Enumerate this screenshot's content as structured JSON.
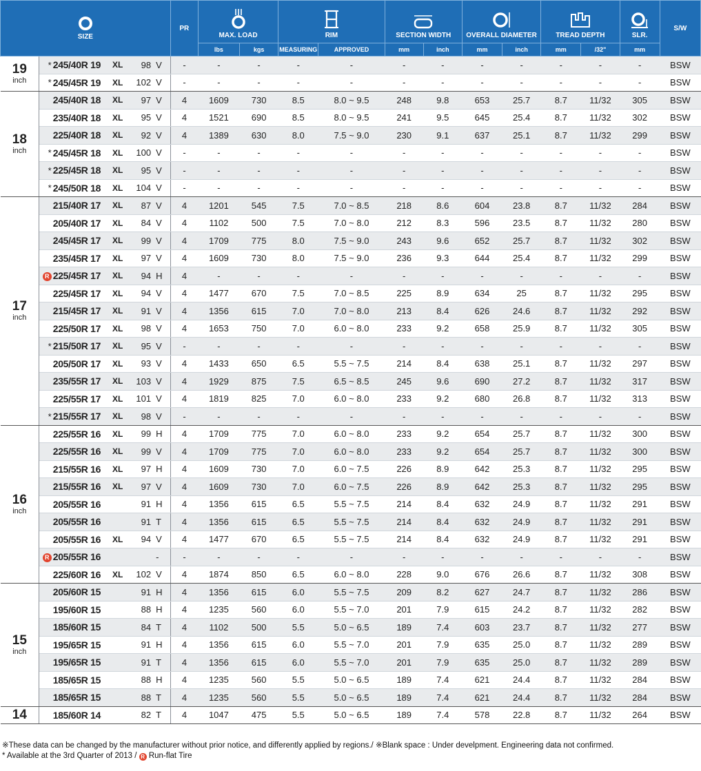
{
  "header": {
    "size": "SIZE",
    "pr": "PR",
    "max_load": "MAX. LOAD",
    "rim": "RIM",
    "section_width": "SECTION WIDTH",
    "overall_diameter": "OVERALL DIAMETER",
    "tread_depth": "TREAD DEPTH",
    "slr": "SLR.",
    "sw": "S/W",
    "sub": {
      "lbs": "lbs",
      "kgs": "kgs",
      "measuring": "MEASURING",
      "approved": "APPROVED",
      "sw_mm": "mm",
      "sw_inch": "inch",
      "od_mm": "mm",
      "od_inch": "inch",
      "td_mm": "mm",
      "td_32": "/32\"",
      "slr_mm": "mm"
    },
    "icons": {
      "size": "tire-ring-icon",
      "max_load": "tire-load-icon",
      "rim": "rim-icon",
      "section_width": "section-width-icon",
      "overall_diameter": "diameter-icon",
      "tread_depth": "tread-depth-icon",
      "slr": "slr-icon"
    }
  },
  "accent": "#1f6eb6",
  "runflat_color": "#e2452f",
  "groups": [
    {
      "rim": "19",
      "unit": "inch",
      "rows": [
        {
          "mark": "*",
          "size": "245/40R 19",
          "xl": "XL",
          "li": "98",
          "sp": "V",
          "pr": "-",
          "lbs": "-",
          "kgs": "-",
          "meas": "-",
          "appr": "-",
          "sw_mm": "-",
          "sw_in": "-",
          "od_mm": "-",
          "od_in": "-",
          "td_mm": "-",
          "td_32": "-",
          "slr": "-",
          "sidewall": "BSW"
        },
        {
          "mark": "*",
          "size": "245/45R 19",
          "xl": "XL",
          "li": "102",
          "sp": "V",
          "pr": "-",
          "lbs": "-",
          "kgs": "-",
          "meas": "-",
          "appr": "-",
          "sw_mm": "-",
          "sw_in": "-",
          "od_mm": "-",
          "od_in": "-",
          "td_mm": "-",
          "td_32": "-",
          "slr": "-",
          "sidewall": "BSW"
        }
      ]
    },
    {
      "rim": "18",
      "unit": "inch",
      "rows": [
        {
          "mark": "",
          "size": "245/40R 18",
          "xl": "XL",
          "li": "97",
          "sp": "V",
          "pr": "4",
          "lbs": "1609",
          "kgs": "730",
          "meas": "8.5",
          "appr": "8.0 ~ 9.5",
          "sw_mm": "248",
          "sw_in": "9.8",
          "od_mm": "653",
          "od_in": "25.7",
          "td_mm": "8.7",
          "td_32": "11/32",
          "slr": "305",
          "sidewall": "BSW"
        },
        {
          "mark": "",
          "size": "235/40R 18",
          "xl": "XL",
          "li": "95",
          "sp": "V",
          "pr": "4",
          "lbs": "1521",
          "kgs": "690",
          "meas": "8.5",
          "appr": "8.0 ~ 9.5",
          "sw_mm": "241",
          "sw_in": "9.5",
          "od_mm": "645",
          "od_in": "25.4",
          "td_mm": "8.7",
          "td_32": "11/32",
          "slr": "302",
          "sidewall": "BSW"
        },
        {
          "mark": "",
          "size": "225/40R 18",
          "xl": "XL",
          "li": "92",
          "sp": "V",
          "pr": "4",
          "lbs": "1389",
          "kgs": "630",
          "meas": "8.0",
          "appr": "7.5 ~ 9.0",
          "sw_mm": "230",
          "sw_in": "9.1",
          "od_mm": "637",
          "od_in": "25.1",
          "td_mm": "8.7",
          "td_32": "11/32",
          "slr": "299",
          "sidewall": "BSW"
        },
        {
          "mark": "*",
          "size": "245/45R 18",
          "xl": "XL",
          "li": "100",
          "sp": "V",
          "pr": "-",
          "lbs": "-",
          "kgs": "-",
          "meas": "-",
          "appr": "-",
          "sw_mm": "-",
          "sw_in": "-",
          "od_mm": "-",
          "od_in": "-",
          "td_mm": "-",
          "td_32": "-",
          "slr": "-",
          "sidewall": "BSW"
        },
        {
          "mark": "*",
          "size": "225/45R 18",
          "xl": "XL",
          "li": "95",
          "sp": "V",
          "pr": "-",
          "lbs": "-",
          "kgs": "-",
          "meas": "-",
          "appr": "-",
          "sw_mm": "-",
          "sw_in": "-",
          "od_mm": "-",
          "od_in": "-",
          "td_mm": "-",
          "td_32": "-",
          "slr": "-",
          "sidewall": "BSW"
        },
        {
          "mark": "*",
          "size": "245/50R 18",
          "xl": "XL",
          "li": "104",
          "sp": "V",
          "pr": "-",
          "lbs": "-",
          "kgs": "-",
          "meas": "-",
          "appr": "-",
          "sw_mm": "-",
          "sw_in": "-",
          "od_mm": "-",
          "od_in": "-",
          "td_mm": "-",
          "td_32": "-",
          "slr": "-",
          "sidewall": "BSW"
        }
      ]
    },
    {
      "rim": "17",
      "unit": "inch",
      "rows": [
        {
          "mark": "",
          "size": "215/40R 17",
          "xl": "XL",
          "li": "87",
          "sp": "V",
          "pr": "4",
          "lbs": "1201",
          "kgs": "545",
          "meas": "7.5",
          "appr": "7.0 ~ 8.5",
          "sw_mm": "218",
          "sw_in": "8.6",
          "od_mm": "604",
          "od_in": "23.8",
          "td_mm": "8.7",
          "td_32": "11/32",
          "slr": "284",
          "sidewall": "BSW"
        },
        {
          "mark": "",
          "size": "205/40R 17",
          "xl": "XL",
          "li": "84",
          "sp": "V",
          "pr": "4",
          "lbs": "1102",
          "kgs": "500",
          "meas": "7.5",
          "appr": "7.0 ~ 8.0",
          "sw_mm": "212",
          "sw_in": "8.3",
          "od_mm": "596",
          "od_in": "23.5",
          "td_mm": "8.7",
          "td_32": "11/32",
          "slr": "280",
          "sidewall": "BSW"
        },
        {
          "mark": "",
          "size": "245/45R 17",
          "xl": "XL",
          "li": "99",
          "sp": "V",
          "pr": "4",
          "lbs": "1709",
          "kgs": "775",
          "meas": "8.0",
          "appr": "7.5 ~ 9.0",
          "sw_mm": "243",
          "sw_in": "9.6",
          "od_mm": "652",
          "od_in": "25.7",
          "td_mm": "8.7",
          "td_32": "11/32",
          "slr": "302",
          "sidewall": "BSW"
        },
        {
          "mark": "",
          "size": "235/45R 17",
          "xl": "XL",
          "li": "97",
          "sp": "V",
          "pr": "4",
          "lbs": "1609",
          "kgs": "730",
          "meas": "8.0",
          "appr": "7.5 ~ 9.0",
          "sw_mm": "236",
          "sw_in": "9.3",
          "od_mm": "644",
          "od_in": "25.4",
          "td_mm": "8.7",
          "td_32": "11/32",
          "slr": "299",
          "sidewall": "BSW"
        },
        {
          "mark": "R",
          "size": "225/45R 17",
          "xl": "XL",
          "li": "94",
          "sp": "H",
          "pr": "4",
          "lbs": "-",
          "kgs": "-",
          "meas": "-",
          "appr": "-",
          "sw_mm": "-",
          "sw_in": "-",
          "od_mm": "-",
          "od_in": "-",
          "td_mm": "-",
          "td_32": "-",
          "slr": "-",
          "sidewall": "BSW"
        },
        {
          "mark": "",
          "size": "225/45R 17",
          "xl": "XL",
          "li": "94",
          "sp": "V",
          "pr": "4",
          "lbs": "1477",
          "kgs": "670",
          "meas": "7.5",
          "appr": "7.0 ~ 8.5",
          "sw_mm": "225",
          "sw_in": "8.9",
          "od_mm": "634",
          "od_in": "25",
          "td_mm": "8.7",
          "td_32": "11/32",
          "slr": "295",
          "sidewall": "BSW"
        },
        {
          "mark": "",
          "size": "215/45R 17",
          "xl": "XL",
          "li": "91",
          "sp": "V",
          "pr": "4",
          "lbs": "1356",
          "kgs": "615",
          "meas": "7.0",
          "appr": "7.0 ~ 8.0",
          "sw_mm": "213",
          "sw_in": "8.4",
          "od_mm": "626",
          "od_in": "24.6",
          "td_mm": "8.7",
          "td_32": "11/32",
          "slr": "292",
          "sidewall": "BSW"
        },
        {
          "mark": "",
          "size": "225/50R 17",
          "xl": "XL",
          "li": "98",
          "sp": "V",
          "pr": "4",
          "lbs": "1653",
          "kgs": "750",
          "meas": "7.0",
          "appr": "6.0 ~ 8.0",
          "sw_mm": "233",
          "sw_in": "9.2",
          "od_mm": "658",
          "od_in": "25.9",
          "td_mm": "8.7",
          "td_32": "11/32",
          "slr": "305",
          "sidewall": "BSW"
        },
        {
          "mark": "*",
          "size": "215/50R 17",
          "xl": "XL",
          "li": "95",
          "sp": "V",
          "pr": "-",
          "lbs": "-",
          "kgs": "-",
          "meas": "-",
          "appr": "-",
          "sw_mm": "-",
          "sw_in": "-",
          "od_mm": "-",
          "od_in": "-",
          "td_mm": "-",
          "td_32": "-",
          "slr": "-",
          "sidewall": "BSW"
        },
        {
          "mark": "",
          "size": "205/50R 17",
          "xl": "XL",
          "li": "93",
          "sp": "V",
          "pr": "4",
          "lbs": "1433",
          "kgs": "650",
          "meas": "6.5",
          "appr": "5.5 ~ 7.5",
          "sw_mm": "214",
          "sw_in": "8.4",
          "od_mm": "638",
          "od_in": "25.1",
          "td_mm": "8.7",
          "td_32": "11/32",
          "slr": "297",
          "sidewall": "BSW"
        },
        {
          "mark": "",
          "size": "235/55R 17",
          "xl": "XL",
          "li": "103",
          "sp": "V",
          "pr": "4",
          "lbs": "1929",
          "kgs": "875",
          "meas": "7.5",
          "appr": "6.5 ~ 8.5",
          "sw_mm": "245",
          "sw_in": "9.6",
          "od_mm": "690",
          "od_in": "27.2",
          "td_mm": "8.7",
          "td_32": "11/32",
          "slr": "317",
          "sidewall": "BSW"
        },
        {
          "mark": "",
          "size": "225/55R 17",
          "xl": "XL",
          "li": "101",
          "sp": "V",
          "pr": "4",
          "lbs": "1819",
          "kgs": "825",
          "meas": "7.0",
          "appr": "6.0 ~ 8.0",
          "sw_mm": "233",
          "sw_in": "9.2",
          "od_mm": "680",
          "od_in": "26.8",
          "td_mm": "8.7",
          "td_32": "11/32",
          "slr": "313",
          "sidewall": "BSW"
        },
        {
          "mark": "*",
          "size": "215/55R 17",
          "xl": "XL",
          "li": "98",
          "sp": "V",
          "pr": "-",
          "lbs": "-",
          "kgs": "-",
          "meas": "-",
          "appr": "-",
          "sw_mm": "-",
          "sw_in": "-",
          "od_mm": "-",
          "od_in": "-",
          "td_mm": "-",
          "td_32": "-",
          "slr": "-",
          "sidewall": "BSW"
        }
      ]
    },
    {
      "rim": "16",
      "unit": "inch",
      "rows": [
        {
          "mark": "",
          "size": "225/55R 16",
          "xl": "XL",
          "li": "99",
          "sp": "H",
          "pr": "4",
          "lbs": "1709",
          "kgs": "775",
          "meas": "7.0",
          "appr": "6.0 ~ 8.0",
          "sw_mm": "233",
          "sw_in": "9.2",
          "od_mm": "654",
          "od_in": "25.7",
          "td_mm": "8.7",
          "td_32": "11/32",
          "slr": "300",
          "sidewall": "BSW"
        },
        {
          "mark": "",
          "size": "225/55R 16",
          "xl": "XL",
          "li": "99",
          "sp": "V",
          "pr": "4",
          "lbs": "1709",
          "kgs": "775",
          "meas": "7.0",
          "appr": "6.0 ~ 8.0",
          "sw_mm": "233",
          "sw_in": "9.2",
          "od_mm": "654",
          "od_in": "25.7",
          "td_mm": "8.7",
          "td_32": "11/32",
          "slr": "300",
          "sidewall": "BSW"
        },
        {
          "mark": "",
          "size": "215/55R 16",
          "xl": "XL",
          "li": "97",
          "sp": "H",
          "pr": "4",
          "lbs": "1609",
          "kgs": "730",
          "meas": "7.0",
          "appr": "6.0 ~ 7.5",
          "sw_mm": "226",
          "sw_in": "8.9",
          "od_mm": "642",
          "od_in": "25.3",
          "td_mm": "8.7",
          "td_32": "11/32",
          "slr": "295",
          "sidewall": "BSW"
        },
        {
          "mark": "",
          "size": "215/55R 16",
          "xl": "XL",
          "li": "97",
          "sp": "V",
          "pr": "4",
          "lbs": "1609",
          "kgs": "730",
          "meas": "7.0",
          "appr": "6.0 ~ 7.5",
          "sw_mm": "226",
          "sw_in": "8.9",
          "od_mm": "642",
          "od_in": "25.3",
          "td_mm": "8.7",
          "td_32": "11/32",
          "slr": "295",
          "sidewall": "BSW"
        },
        {
          "mark": "",
          "size": "205/55R 16",
          "xl": "",
          "li": "91",
          "sp": "H",
          "pr": "4",
          "lbs": "1356",
          "kgs": "615",
          "meas": "6.5",
          "appr": "5.5 ~ 7.5",
          "sw_mm": "214",
          "sw_in": "8.4",
          "od_mm": "632",
          "od_in": "24.9",
          "td_mm": "8.7",
          "td_32": "11/32",
          "slr": "291",
          "sidewall": "BSW"
        },
        {
          "mark": "",
          "size": "205/55R 16",
          "xl": "",
          "li": "91",
          "sp": "T",
          "pr": "4",
          "lbs": "1356",
          "kgs": "615",
          "meas": "6.5",
          "appr": "5.5 ~ 7.5",
          "sw_mm": "214",
          "sw_in": "8.4",
          "od_mm": "632",
          "od_in": "24.9",
          "td_mm": "8.7",
          "td_32": "11/32",
          "slr": "291",
          "sidewall": "BSW"
        },
        {
          "mark": "",
          "size": "205/55R 16",
          "xl": "XL",
          "li": "94",
          "sp": "V",
          "pr": "4",
          "lbs": "1477",
          "kgs": "670",
          "meas": "6.5",
          "appr": "5.5 ~ 7.5",
          "sw_mm": "214",
          "sw_in": "8.4",
          "od_mm": "632",
          "od_in": "24.9",
          "td_mm": "8.7",
          "td_32": "11/32",
          "slr": "291",
          "sidewall": "BSW"
        },
        {
          "mark": "R",
          "size": "205/55R 16",
          "xl": "",
          "li": "",
          "sp": "-",
          "pr": "-",
          "lbs": "-",
          "kgs": "-",
          "meas": "-",
          "appr": "-",
          "sw_mm": "-",
          "sw_in": "-",
          "od_mm": "-",
          "od_in": "-",
          "td_mm": "-",
          "td_32": "-",
          "slr": "-",
          "sidewall": "BSW"
        },
        {
          "mark": "",
          "size": "225/60R 16",
          "xl": "XL",
          "li": "102",
          "sp": "V",
          "pr": "4",
          "lbs": "1874",
          "kgs": "850",
          "meas": "6.5",
          "appr": "6.0 ~ 8.0",
          "sw_mm": "228",
          "sw_in": "9.0",
          "od_mm": "676",
          "od_in": "26.6",
          "td_mm": "8.7",
          "td_32": "11/32",
          "slr": "308",
          "sidewall": "BSW"
        }
      ]
    },
    {
      "rim": "15",
      "unit": "inch",
      "rows": [
        {
          "mark": "",
          "size": "205/60R 15",
          "xl": "",
          "li": "91",
          "sp": "H",
          "pr": "4",
          "lbs": "1356",
          "kgs": "615",
          "meas": "6.0",
          "appr": "5.5 ~ 7.5",
          "sw_mm": "209",
          "sw_in": "8.2",
          "od_mm": "627",
          "od_in": "24.7",
          "td_mm": "8.7",
          "td_32": "11/32",
          "slr": "286",
          "sidewall": "BSW"
        },
        {
          "mark": "",
          "size": "195/60R 15",
          "xl": "",
          "li": "88",
          "sp": "H",
          "pr": "4",
          "lbs": "1235",
          "kgs": "560",
          "meas": "6.0",
          "appr": "5.5 ~ 7.0",
          "sw_mm": "201",
          "sw_in": "7.9",
          "od_mm": "615",
          "od_in": "24.2",
          "td_mm": "8.7",
          "td_32": "11/32",
          "slr": "282",
          "sidewall": "BSW"
        },
        {
          "mark": "",
          "size": "185/60R 15",
          "xl": "",
          "li": "84",
          "sp": "T",
          "pr": "4",
          "lbs": "1102",
          "kgs": "500",
          "meas": "5.5",
          "appr": "5.0 ~ 6.5",
          "sw_mm": "189",
          "sw_in": "7.4",
          "od_mm": "603",
          "od_in": "23.7",
          "td_mm": "8.7",
          "td_32": "11/32",
          "slr": "277",
          "sidewall": "BSW"
        },
        {
          "mark": "",
          "size": "195/65R 15",
          "xl": "",
          "li": "91",
          "sp": "H",
          "pr": "4",
          "lbs": "1356",
          "kgs": "615",
          "meas": "6.0",
          "appr": "5.5 ~ 7.0",
          "sw_mm": "201",
          "sw_in": "7.9",
          "od_mm": "635",
          "od_in": "25.0",
          "td_mm": "8.7",
          "td_32": "11/32",
          "slr": "289",
          "sidewall": "BSW"
        },
        {
          "mark": "",
          "size": "195/65R 15",
          "xl": "",
          "li": "91",
          "sp": "T",
          "pr": "4",
          "lbs": "1356",
          "kgs": "615",
          "meas": "6.0",
          "appr": "5.5 ~ 7.0",
          "sw_mm": "201",
          "sw_in": "7.9",
          "od_mm": "635",
          "od_in": "25.0",
          "td_mm": "8.7",
          "td_32": "11/32",
          "slr": "289",
          "sidewall": "BSW"
        },
        {
          "mark": "",
          "size": "185/65R 15",
          "xl": "",
          "li": "88",
          "sp": "H",
          "pr": "4",
          "lbs": "1235",
          "kgs": "560",
          "meas": "5.5",
          "appr": "5.0 ~ 6.5",
          "sw_mm": "189",
          "sw_in": "7.4",
          "od_mm": "621",
          "od_in": "24.4",
          "td_mm": "8.7",
          "td_32": "11/32",
          "slr": "284",
          "sidewall": "BSW"
        },
        {
          "mark": "",
          "size": "185/65R 15",
          "xl": "",
          "li": "88",
          "sp": "T",
          "pr": "4",
          "lbs": "1235",
          "kgs": "560",
          "meas": "5.5",
          "appr": "5.0 ~ 6.5",
          "sw_mm": "189",
          "sw_in": "7.4",
          "od_mm": "621",
          "od_in": "24.4",
          "td_mm": "8.7",
          "td_32": "11/32",
          "slr": "284",
          "sidewall": "BSW"
        }
      ]
    },
    {
      "rim": "14",
      "unit": "",
      "rows": [
        {
          "mark": "",
          "size": "185/60R 14",
          "xl": "",
          "li": "82",
          "sp": "T",
          "pr": "4",
          "lbs": "1047",
          "kgs": "475",
          "meas": "5.5",
          "appr": "5.0 ~ 6.5",
          "sw_mm": "189",
          "sw_in": "7.4",
          "od_mm": "578",
          "od_in": "22.8",
          "td_mm": "8.7",
          "td_32": "11/32",
          "slr": "264",
          "sidewall": "BSW"
        }
      ]
    }
  ],
  "notes": {
    "line1": "※These data can be changed by the manufacturer without prior notice, and differently applied by regions./ ※Blank space : Under develpment. Engineering data not confirmed.",
    "line2_prefix": "* Available at the 3rd Quarter of 2013 /",
    "runflat_letter": "R",
    "line2_suffix": "Run-flat Tire"
  }
}
